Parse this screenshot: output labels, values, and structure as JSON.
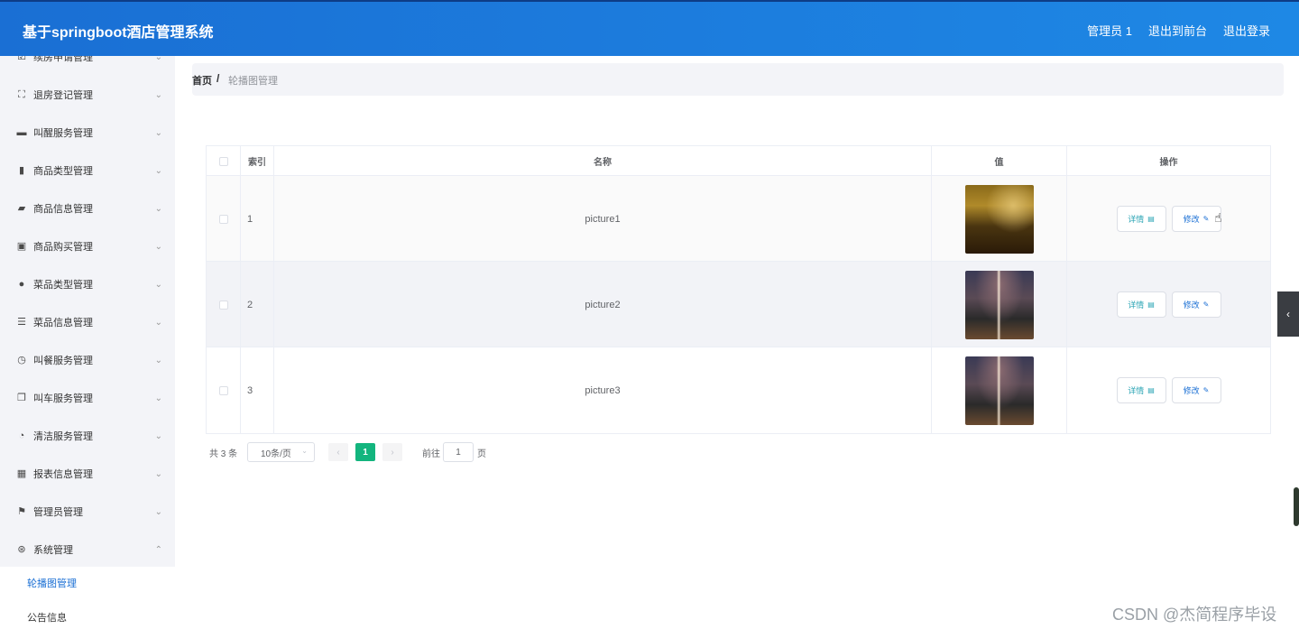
{
  "header": {
    "title": "基于springboot酒店管理系统",
    "nav": [
      "管理员 1",
      "退出到前台",
      "退出登录"
    ]
  },
  "sidebar": {
    "items": [
      {
        "label": "续房申请管理",
        "icon": "checkbox-icon"
      },
      {
        "label": "退房登记管理",
        "icon": "fullscreen-icon"
      },
      {
        "label": "叫醒服务管理",
        "icon": "ticket-icon"
      },
      {
        "label": "商品类型管理",
        "icon": "clipboard-icon"
      },
      {
        "label": "商品信息管理",
        "icon": "briefcase-icon"
      },
      {
        "label": "商品购买管理",
        "icon": "checklist-icon"
      },
      {
        "label": "菜品类型管理",
        "icon": "location-icon"
      },
      {
        "label": "菜品信息管理",
        "icon": "menu-icon"
      },
      {
        "label": "叫餐服务管理",
        "icon": "dashboard-icon"
      },
      {
        "label": "叫车服务管理",
        "icon": "copy-icon"
      },
      {
        "label": "清洁服务管理",
        "icon": "clock-icon"
      },
      {
        "label": "报表信息管理",
        "icon": "grid-icon"
      },
      {
        "label": "管理员管理",
        "icon": "flag-icon"
      },
      {
        "label": "系统管理",
        "icon": "help-icon"
      }
    ],
    "sub_items": [
      "轮播图管理",
      "公告信息"
    ]
  },
  "breadcrumb": {
    "home": "首页",
    "sep": "/",
    "current": "轮播图管理"
  },
  "table": {
    "columns": [
      "索引",
      "名称",
      "值",
      "操作"
    ],
    "rows": [
      {
        "index": "1",
        "name": "picture1"
      },
      {
        "index": "2",
        "name": "picture2"
      },
      {
        "index": "3",
        "name": "picture3"
      }
    ],
    "detail_label": "详情",
    "edit_label": "修改"
  },
  "pagination": {
    "total": "共 3 条",
    "page_size": "10条/页",
    "current_page": "1",
    "goto_label": "前往",
    "goto_value": "1",
    "page_suffix": "页"
  },
  "watermark": "CSDN @杰简程序毕设",
  "colors": {
    "header": "#1a6fd4",
    "active_page": "#13b57e",
    "sidebar_bg": "#f3f4f8"
  }
}
